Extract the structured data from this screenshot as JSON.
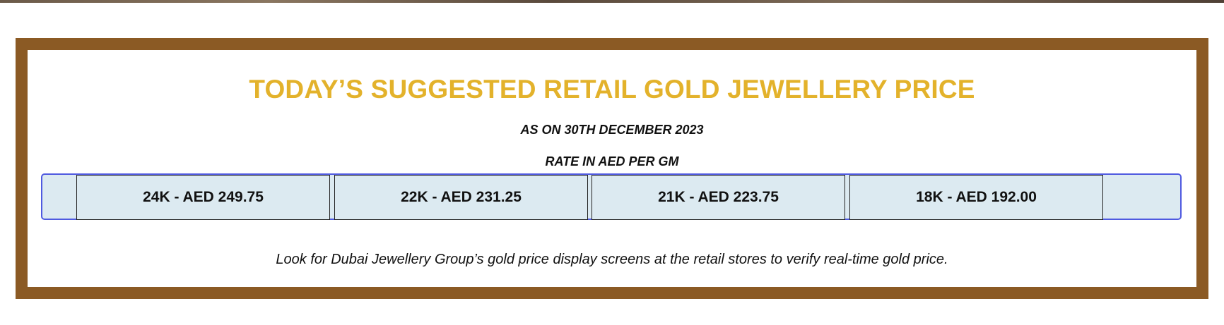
{
  "panel": {
    "title": "TODAY’S SUGGESTED RETAIL GOLD JEWELLERY PRICE",
    "date_line": "AS ON 30TH DECEMBER 2023",
    "rate_unit_line": "RATE IN AED PER GM",
    "rates": [
      {
        "label": "24K - AED 249.75"
      },
      {
        "label": "22K - AED 231.25"
      },
      {
        "label": "21K - AED 223.75"
      },
      {
        "label": "18K - AED 192.00"
      }
    ],
    "note": "Look for Dubai Jewellery Group’s gold price display screens at the retail stores to verify real-time gold price."
  },
  "colors": {
    "frame_border": "#8b5a24",
    "title_gold": "#e3b22b",
    "rate_bar_background": "#dceaf1",
    "rate_bar_border": "#4f5ae0",
    "text": "#111111"
  }
}
